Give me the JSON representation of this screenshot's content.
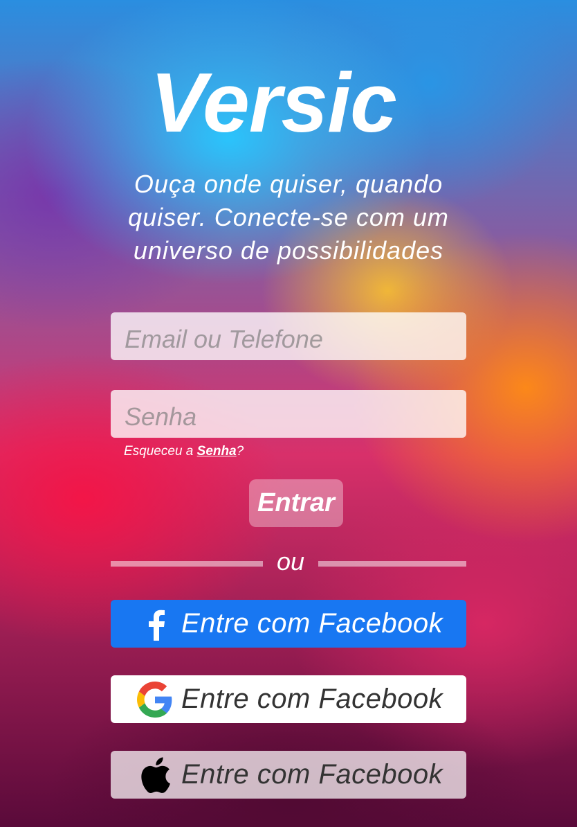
{
  "app": {
    "title": "Versic",
    "tagline": "Ouça onde quiser, quando quiser. Conecte-se com um universo de possibilidades"
  },
  "login": {
    "email_placeholder": "Email ou Telefone",
    "email_value": "",
    "password_placeholder": "Senha",
    "password_value": "",
    "forgot_prefix": "Esqueceu a ",
    "forgot_link": "Senha",
    "forgot_suffix": "?",
    "submit_label": "Entrar"
  },
  "separator": {
    "label": "ou"
  },
  "social": [
    {
      "label": "Entre com Facebook",
      "icon": "facebook-icon",
      "color": "#1877F2"
    },
    {
      "label": "Entre com Facebook",
      "icon": "google-icon",
      "color": "#FFFFFF"
    },
    {
      "label": "Entre com Facebook",
      "icon": "apple-icon",
      "color": "#FFFFFF"
    }
  ]
}
